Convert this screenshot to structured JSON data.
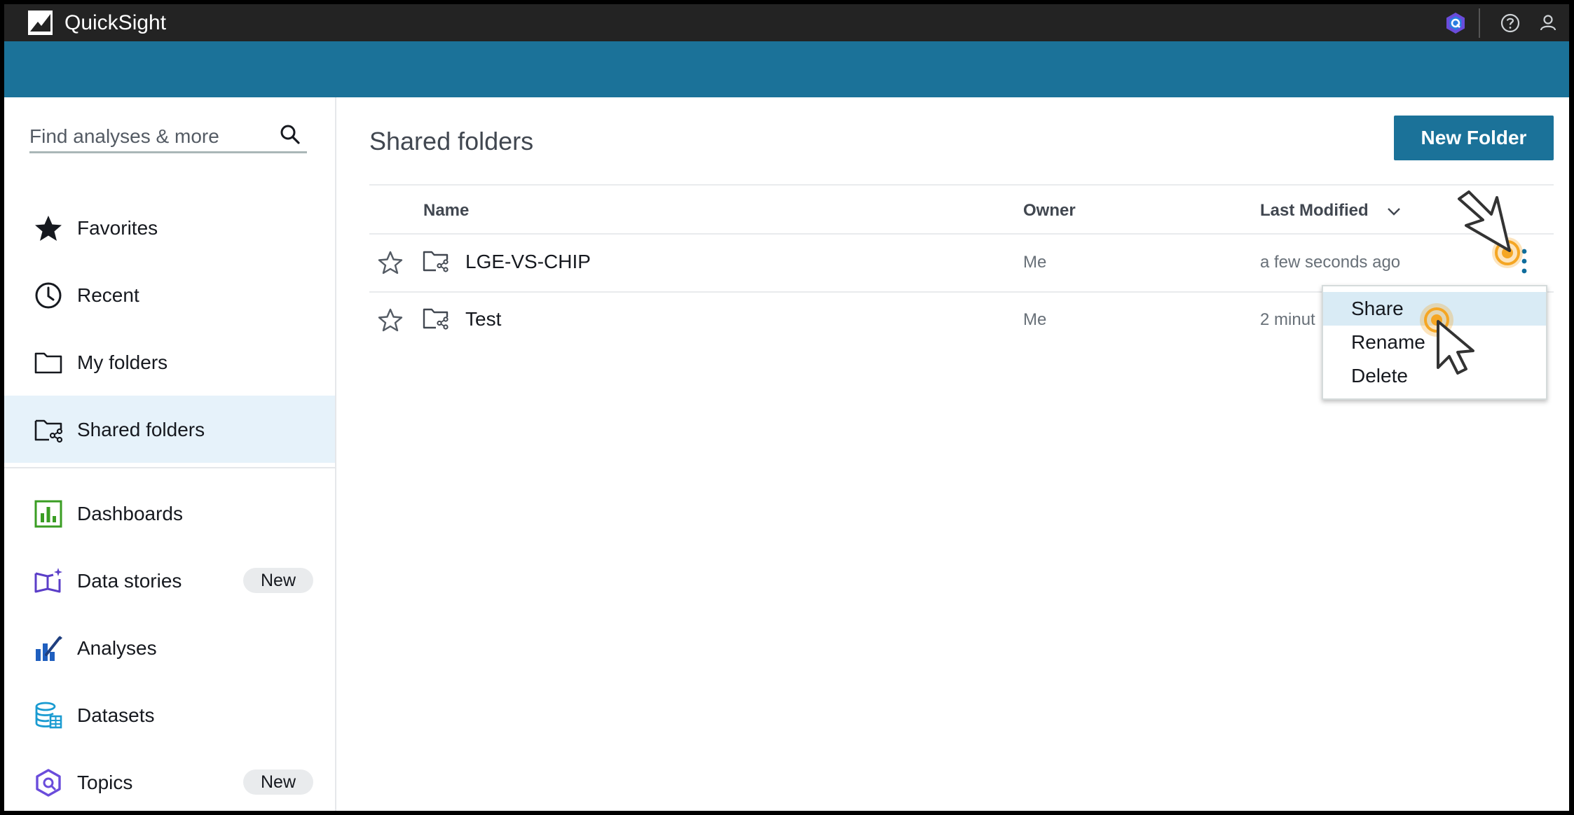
{
  "app": {
    "title": "QuickSight",
    "logo_icon": "quicksight-logo-icon",
    "toolbar_icons": [
      "amazon-q-icon",
      "help-icon",
      "user-icon"
    ]
  },
  "sidebar": {
    "search": {
      "placeholder": "Find analyses & more",
      "value": ""
    },
    "items": [
      {
        "label": "Favorites",
        "icon": "star-filled-icon",
        "active": false
      },
      {
        "label": "Recent",
        "icon": "clock-icon",
        "active": false
      },
      {
        "label": "My folders",
        "icon": "folder-icon",
        "active": false
      },
      {
        "label": "Shared folders",
        "icon": "shared-folder-icon",
        "active": true
      },
      {
        "label": "Dashboards",
        "icon": "dashboard-icon",
        "active": false
      },
      {
        "label": "Data stories",
        "icon": "data-stories-icon",
        "badge": "New",
        "active": false
      },
      {
        "label": "Analyses",
        "icon": "analyses-icon",
        "active": false
      },
      {
        "label": "Datasets",
        "icon": "datasets-icon",
        "active": false
      },
      {
        "label": "Topics",
        "icon": "topics-icon",
        "badge": "New",
        "active": false
      }
    ]
  },
  "main": {
    "title": "Shared folders",
    "new_folder_label": "New Folder",
    "columns": {
      "name": "Name",
      "owner": "Owner",
      "last_modified": "Last Modified"
    },
    "rows": [
      {
        "name": "LGE-VS-CHIP",
        "owner": "Me",
        "last_modified": "a few seconds ago"
      },
      {
        "name": "Test",
        "owner": "Me",
        "last_modified": "2 minut"
      }
    ],
    "row_menu": {
      "items": [
        "Share",
        "Rename",
        "Delete"
      ],
      "highlighted": "Share"
    }
  },
  "colors": {
    "topbar": "#232323",
    "banner": "#1b7299",
    "primary_button": "#1b7299",
    "active_nav_bg": "#e6f2fa",
    "menu_highlight": "#d9ebf5",
    "click_indicator": "#f5a623"
  }
}
